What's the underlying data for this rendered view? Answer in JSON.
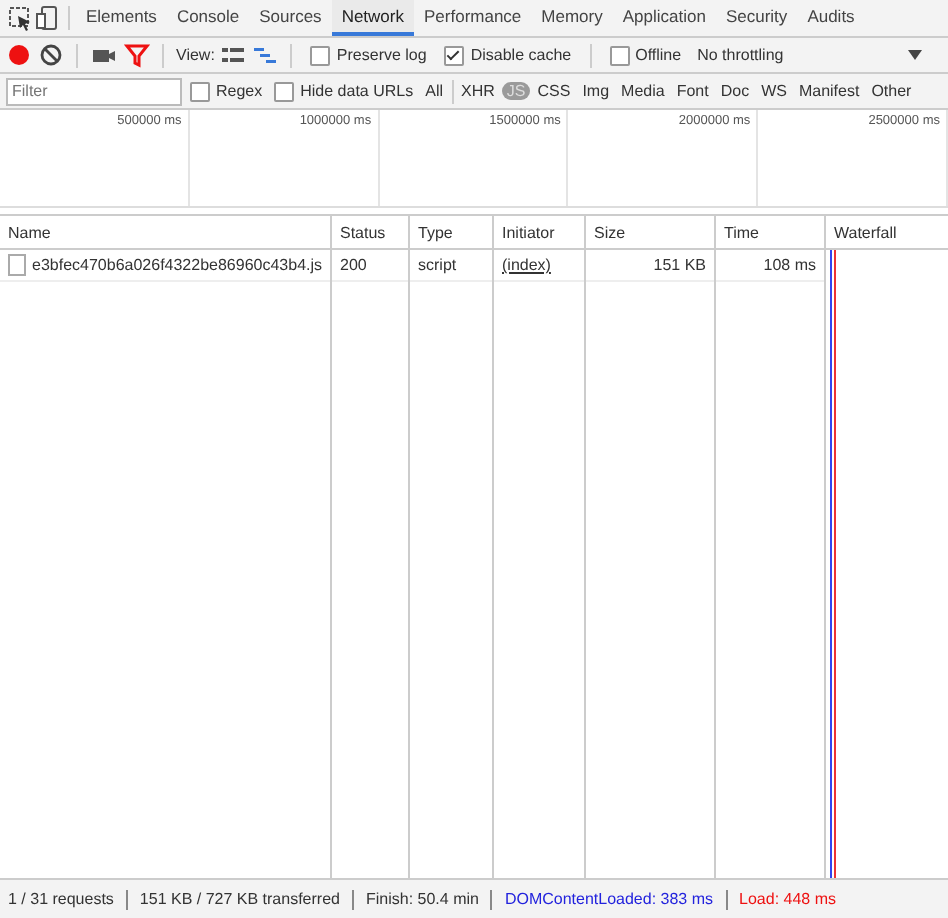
{
  "tabs": [
    {
      "label": "Elements",
      "selected": false
    },
    {
      "label": "Console",
      "selected": false
    },
    {
      "label": "Sources",
      "selected": false
    },
    {
      "label": "Network",
      "selected": true
    },
    {
      "label": "Performance",
      "selected": false
    },
    {
      "label": "Memory",
      "selected": false
    },
    {
      "label": "Application",
      "selected": false
    },
    {
      "label": "Security",
      "selected": false
    },
    {
      "label": "Audits",
      "selected": false
    }
  ],
  "toolbar": {
    "recording": true,
    "filter_shown": true,
    "view_label": "View:",
    "large_rows": false,
    "waterfall_overview": true,
    "checkboxes": [
      {
        "label": "Preserve log",
        "checked": false
      },
      {
        "label": "Disable cache",
        "checked": true
      },
      {
        "label": "Offline",
        "checked": false
      }
    ],
    "throttling": "No throttling"
  },
  "filter_bar": {
    "placeholder": "Filter",
    "checkboxes": [
      {
        "label": "Regex",
        "checked": false
      },
      {
        "label": "Hide data URLs",
        "checked": false
      }
    ],
    "types": [
      {
        "label": "All",
        "selected": false
      },
      {
        "label": "XHR",
        "selected": false
      },
      {
        "label": "JS",
        "selected": true
      },
      {
        "label": "CSS",
        "selected": false
      },
      {
        "label": "Img",
        "selected": false
      },
      {
        "label": "Media",
        "selected": false
      },
      {
        "label": "Font",
        "selected": false
      },
      {
        "label": "Doc",
        "selected": false
      },
      {
        "label": "WS",
        "selected": false
      },
      {
        "label": "Manifest",
        "selected": false
      },
      {
        "label": "Other",
        "selected": false
      }
    ]
  },
  "overview": {
    "ticks": [
      "500000 ms",
      "1000000 ms",
      "1500000 ms",
      "2000000 ms",
      "2500000 ms"
    ]
  },
  "table": {
    "columns": [
      "Name",
      "Status",
      "Type",
      "Initiator",
      "Size",
      "Time",
      "Waterfall"
    ],
    "rows": [
      {
        "name": "e3bfec470b6a026f4322be86960c43b4.js",
        "status": "200",
        "type": "script",
        "initiator": "(index)",
        "size": "151 KB",
        "time": "108 ms"
      }
    ]
  },
  "status_bar": [
    {
      "text": "1 / 31 requests",
      "kind": "plain"
    },
    {
      "text": "151 KB / 727 KB transferred",
      "kind": "plain"
    },
    {
      "text": "Finish: 50.4 min",
      "kind": "plain"
    },
    {
      "text": "DOMContentLoaded: 383 ms",
      "kind": "dom"
    },
    {
      "text": "Load: 448 ms",
      "kind": "load"
    }
  ]
}
